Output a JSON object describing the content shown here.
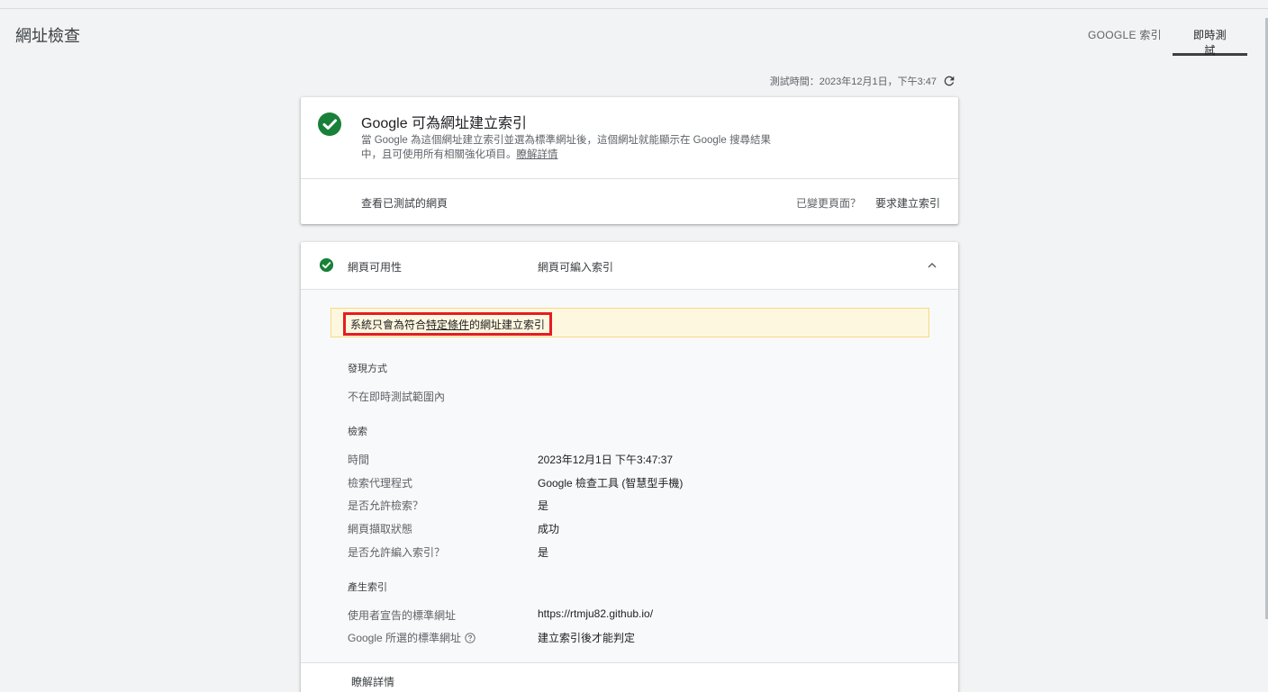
{
  "header": {
    "title": "網址檢查",
    "tabs": [
      {
        "label": "GOOGLE 索引",
        "active": false
      },
      {
        "label": "即時測試",
        "active": true
      }
    ]
  },
  "test_time": "測試時間：2023年12月1日，下午3:47",
  "summary_card": {
    "title": "Google 可為網址建立索引",
    "description": "當 Google 為這個網址建立索引並選為標準網址後，這個網址就能顯示在 Google 搜尋結果中，且可使用所有相關強化項目。",
    "learn_more": "瞭解詳情",
    "view_tested_page": "查看已測試的網頁",
    "page_changed": "已變更頁面？",
    "request_indexing": "要求建立索引"
  },
  "availability_card": {
    "label": "網頁可用性",
    "value": "網頁可編入索引",
    "notice_prefix": "系統只會為符合",
    "notice_link": "特定條件",
    "notice_suffix": "的網址建立索引",
    "discovery": {
      "title": "發現方式",
      "text": "不在即時測試範圍內"
    },
    "crawl": {
      "title": "檢索",
      "rows": [
        {
          "label": "時間",
          "value": "2023年12月1日 下午3:47:37"
        },
        {
          "label": "檢索代理程式",
          "value": "Google 檢查工具 (智慧型手機)"
        },
        {
          "label": "是否允許檢索？",
          "value": "是"
        },
        {
          "label": "網頁擷取狀態",
          "value": "成功"
        },
        {
          "label": "是否允許編入索引？",
          "value": "是"
        }
      ]
    },
    "indexing": {
      "title": "產生索引",
      "rows": [
        {
          "label": "使用者宣告的標準網址",
          "value": "https://rtmju82.github.io/"
        },
        {
          "label": "Google 所選的標準網址",
          "value": "建立索引後才能判定"
        }
      ]
    },
    "learn_more": "瞭解詳情"
  },
  "colors": {
    "success": "#188038",
    "warning_bg": "#fef7e0",
    "highlight_border": "#e51c23"
  }
}
